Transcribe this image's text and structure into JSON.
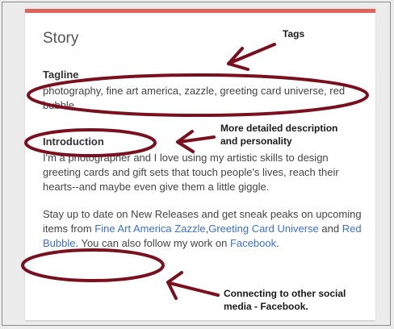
{
  "card": {
    "title": "Story"
  },
  "tagline": {
    "heading": "Tagline",
    "text": "photography, fine art america, zazzle, greeting card universe, red bubble"
  },
  "introduction": {
    "heading": "Introduction",
    "paragraph1": "I'm a photographer and I love using my artistic skills to design greeting cards and gift sets that touch people's lives, reach their hearts--and maybe even give them a little giggle.",
    "p2_before": "Stay up to date on New Releases and get sneak peaks on upcoming items from ",
    "link_fine_art_america": "Fine Art America",
    "link_zazzle": "Zazzle",
    "p2_sep1": ",",
    "link_greeting_card_universe": "Greeting Card Universe",
    "p2_and": " and ",
    "link_red_bubble": "Red Bubble",
    "p2_mid": ". You can also follow my work on ",
    "link_facebook": "Facebook",
    "p2_end": "."
  },
  "annotations": {
    "tags_note": "Tags",
    "description_note_line1": "More detailed description",
    "description_note_line2": "and personality",
    "social_note_line1": "Connecting to other social",
    "social_note_line2": "media - Facebook."
  },
  "colors": {
    "accent": "#e0635a",
    "link": "#3b6fd6",
    "annotation": "#7a0f1e"
  }
}
